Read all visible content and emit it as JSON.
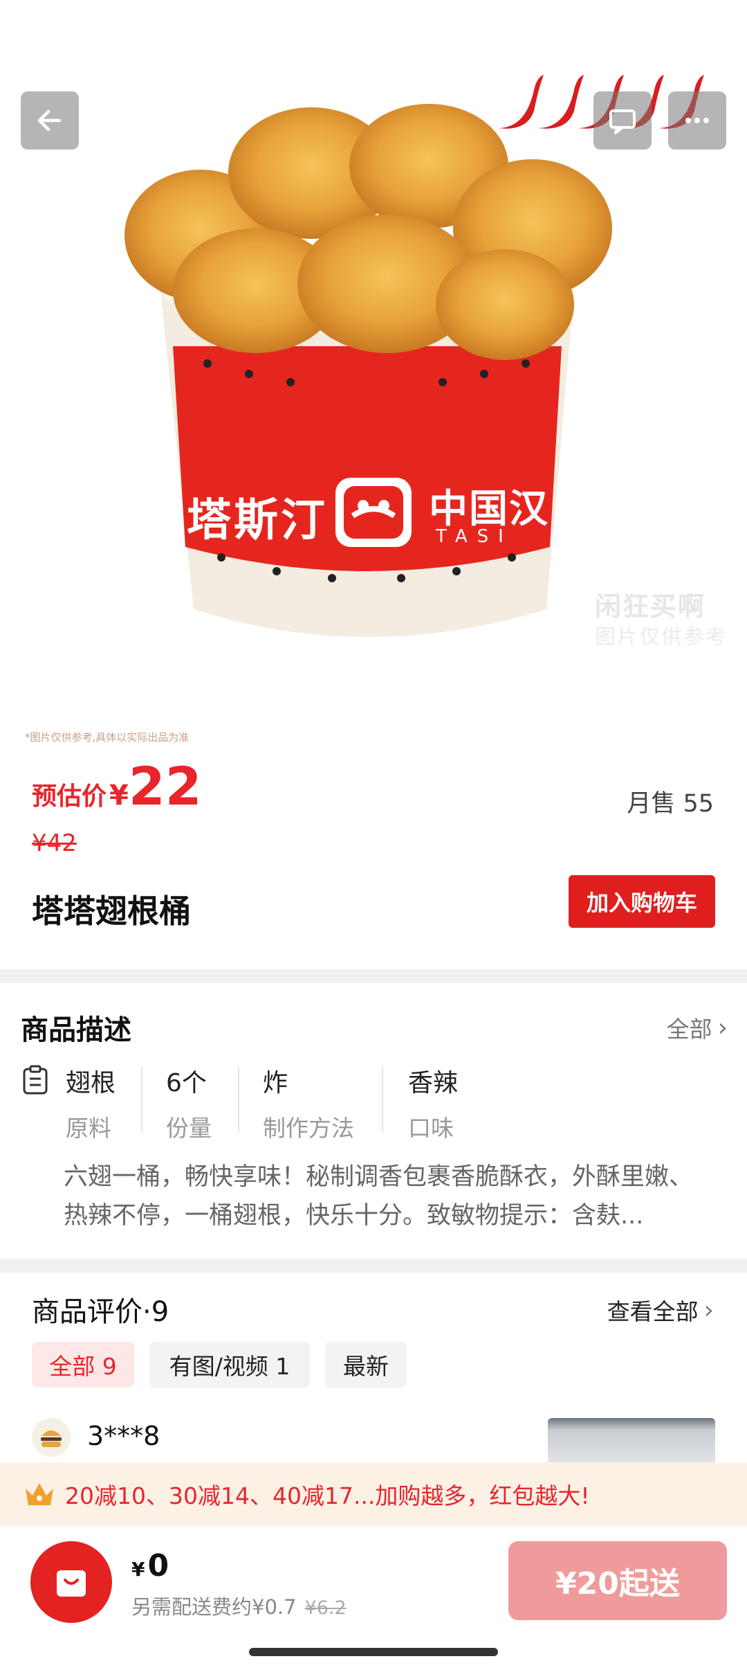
{
  "hero": {
    "disclaimer": "*图片仅供参考,具体以实际出品为准",
    "watermark_line1": "闲狂买啊",
    "watermark_line2": "图片仅供参考",
    "bucket_text_left": "塔斯汀",
    "bucket_text_right": "中国汉",
    "bucket_text_sub": "TASI",
    "icons": [
      "back-arrow-icon",
      "chat-icon",
      "more-icon",
      "chili-icon"
    ]
  },
  "price": {
    "label": "预估价",
    "currency": "¥",
    "value": "22",
    "original": "¥42",
    "monthly_sales": "月售 55"
  },
  "product": {
    "name": "塔塔翅根桶",
    "add_to_cart": "加入购物车"
  },
  "description": {
    "title": "商品描述",
    "all_label": "全部",
    "attributes": [
      {
        "value": "翅根",
        "label": "原料"
      },
      {
        "value": "6个",
        "label": "份量"
      },
      {
        "value": "炸",
        "label": "制作方法"
      },
      {
        "value": "香辣",
        "label": "口味"
      }
    ],
    "text": "六翅一桶，畅快享味！秘制调香包裹香脆酥衣，外酥里嫩、热辣不停，一桶翅根，快乐十分。致敏物提示：含麸..."
  },
  "reviews": {
    "title": "商品评价·9",
    "view_all": "查看全部",
    "filters": [
      "全部 9",
      "有图/视频 1",
      "最新"
    ],
    "first_user": "3***8"
  },
  "promo": {
    "text": "20减10、30减14、40减17...加购越多，红包越大!"
  },
  "bottom_bar": {
    "currency": "¥",
    "total": "0",
    "delivery_note": "另需配送费约¥0.7",
    "delivery_original": "¥6.2",
    "min_order": "¥20起送"
  },
  "colors": {
    "accent_red": "#e8252b",
    "button_red": "#e01e1e",
    "min_order_pink": "#ef9b9b",
    "promo_bg": "#fdf1e6"
  }
}
